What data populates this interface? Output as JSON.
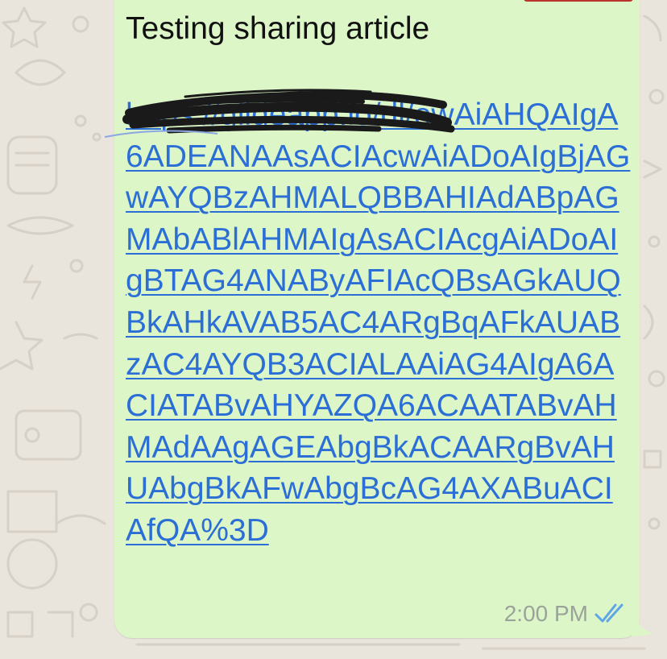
{
  "message": {
    "text": "Testing sharing article",
    "link_visible_text": "https://glideapp.io/dl/ewAiAHQAIgA6ADEANAAsACIAcwAiADoAIgBjAGwAYQBzAHMALQBBAHIAdABpAGMAbABlAHMAIgAsACIAcgAiADoAIgBTAG4ANAByAFIAcQBsAGkAUQBkAHkAVAB5AC4ARgBqAFkAUABzAC4AYQB3ACIALAAiAG4AIgA6ACIATABvAHYAZQA6ACAATABvAHMAdAAgAGEAbgBkACAARgBvAHUAbgBkAFwAbgBcAG4AXABuACIAfQA%3D",
    "time": "2:00 PM",
    "status_icon": "double-check-icon",
    "redacted": true
  },
  "colors": {
    "bubble": "#dcf6c8",
    "link": "#2b6fd6",
    "text": "#111111",
    "time": "#9aa39a",
    "read_receipt": "#5fa6e6",
    "wallpaper": "#e9e4dc",
    "accent": "#b9342b"
  }
}
